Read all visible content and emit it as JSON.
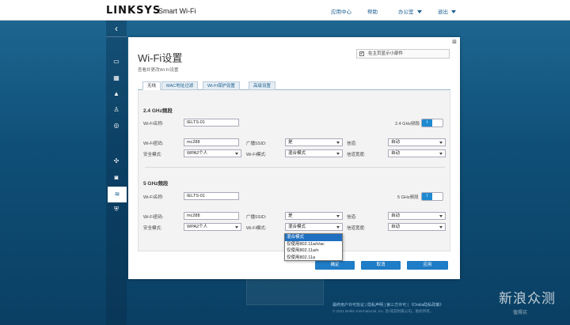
{
  "header": {
    "brand": "LINKSYS",
    "brand_sub": "Smart Wi-Fi",
    "nav_help_center": "应用中心",
    "nav_help": "帮助",
    "nav_office": "办公室",
    "nav_logout": "退出"
  },
  "dialog": {
    "title": "Wi-Fi设置",
    "subtitle": "查看并更改Wi-Fi设置",
    "show_widget_label": "在主页显示小部件",
    "show_widget_checked": "✔",
    "close": "⊠",
    "tabs": [
      "无线",
      "MAC地址过滤",
      "Wi-Fi保护设置",
      "高级设置"
    ]
  },
  "band24": {
    "title": "2.4 GHz频段",
    "name_label": "Wi-Fi名称:",
    "name_value": "IELTS-01",
    "band_label": "2.4 GHz频段",
    "toggle": "I",
    "password_label": "Wi-Fi密码:",
    "password_value": "mc288",
    "broadcast_label": "广播SSID:",
    "broadcast_value": "是",
    "channel_label": "信道:",
    "channel_value": "自动",
    "security_label": "安全模式:",
    "security_value": "WPA2个人",
    "mode_label": "Wi-Fi模式:",
    "mode_value": "混合模式",
    "width_label": "信道宽度:",
    "width_value": "自动"
  },
  "band5": {
    "title": "5 GHz频段",
    "name_label": "Wi-Fi名称:",
    "name_value": "IELTS-01",
    "band_label": "5 GHz频段",
    "toggle": "I",
    "password_label": "Wi-Fi密码:",
    "password_value": "mc288",
    "broadcast_label": "广播SSID:",
    "broadcast_value": "是",
    "channel_label": "信道:",
    "channel_value": "自动",
    "security_label": "安全模式:",
    "security_value": "WPA2个人",
    "mode_label": "Wi-Fi模式:",
    "mode_value": "混合模式",
    "width_label": "信道宽度:",
    "width_value": "自动",
    "mode_options": [
      "混合模式",
      "仅使用802.11a/n/ac",
      "仅使用802.11a/n",
      "仅使用802.11a"
    ]
  },
  "buttons": {
    "ok": "确定",
    "cancel": "取消",
    "apply": "应用"
  },
  "footer": {
    "links": "最终用户许可协议 | 隐私声明 | 第三方许可 | 《Ookla隐私政策》",
    "copyright": "© 2021 Belkin International, Inc. 及/或其附属公司。版权所有。"
  },
  "watermark": {
    "main": "新浪众测",
    "sub": "值得买"
  }
}
